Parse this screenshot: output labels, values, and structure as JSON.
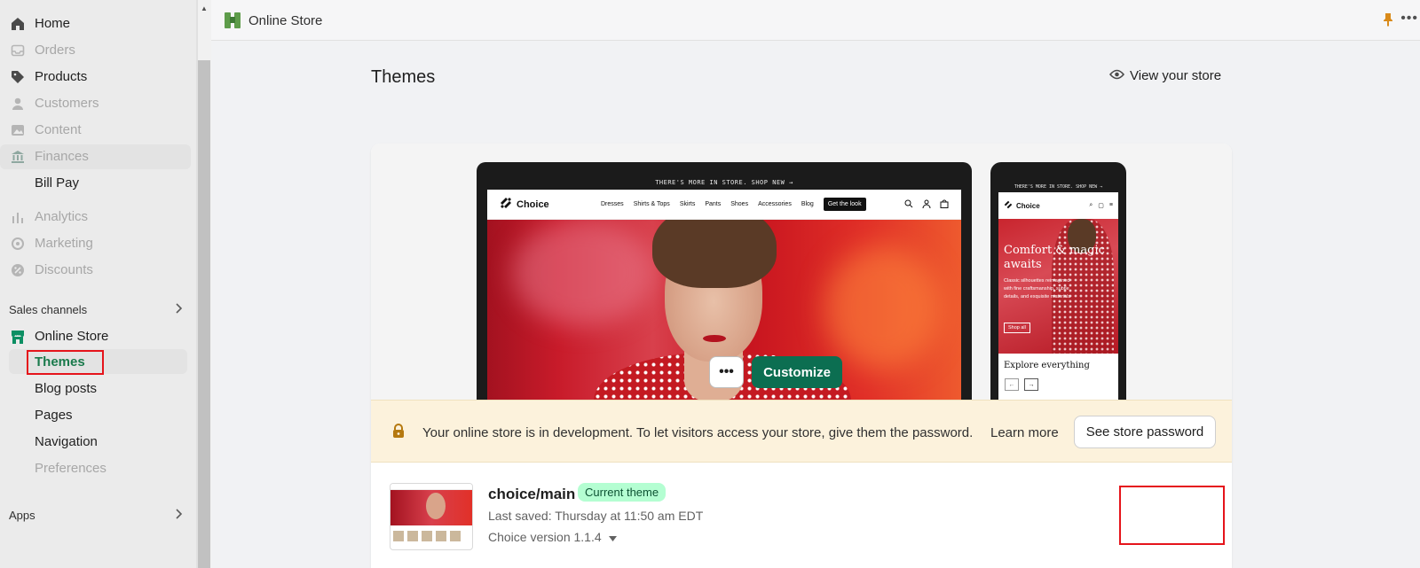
{
  "sidebar": {
    "main_items": [
      {
        "label": "Home",
        "icon": "home-icon"
      },
      {
        "label": "Orders",
        "icon": "inbox-icon"
      },
      {
        "label": "Products",
        "icon": "tag-icon"
      },
      {
        "label": "Customers",
        "icon": "person-icon"
      },
      {
        "label": "Content",
        "icon": "image-icon"
      },
      {
        "label": "Finances",
        "icon": "bank-icon"
      },
      {
        "label": "Bill Pay"
      },
      {
        "label": "Analytics",
        "icon": "bar-chart-icon"
      },
      {
        "label": "Marketing",
        "icon": "target-icon"
      },
      {
        "label": "Discounts",
        "icon": "discount-icon"
      }
    ],
    "sales_channels_label": "Sales channels",
    "online_store": {
      "label": "Online Store",
      "icon": "store-icon"
    },
    "sub_items": [
      {
        "label": "Themes"
      },
      {
        "label": "Blog posts"
      },
      {
        "label": "Pages"
      },
      {
        "label": "Navigation"
      },
      {
        "label": "Preferences"
      }
    ],
    "apps_label": "Apps"
  },
  "topbar": {
    "title": "Online Store",
    "more_label": "•••"
  },
  "page": {
    "title": "Themes",
    "view_store_label": "View your store"
  },
  "preview": {
    "laptop": {
      "announcement": "THERE'S MORE IN STORE. SHOP NEW →",
      "brand": "Choice",
      "links": [
        "Dresses",
        "Shirts & Tops",
        "Skirts",
        "Pants",
        "Shoes",
        "Accessories",
        "Blog"
      ],
      "cta": "Get the look"
    },
    "phone": {
      "announcement": "THERE'S MORE IN STORE. SHOP NEW →",
      "brand": "Choice",
      "hero_title": "Comfort & magic awaits",
      "hero_text": "Classic silhouettes reimagined with fine craftsmanship, subtle details, and exquisite materials",
      "hero_button": "Shop all",
      "explore": "Explore everything",
      "arrow_prev": "←",
      "arrow_next": "→"
    }
  },
  "banner": {
    "message": "Your online store is in development. To let visitors access your store, give them the password.",
    "learn_more": "Learn more",
    "password_button": "See store password"
  },
  "theme": {
    "name": "choice/main",
    "badge": "Current theme",
    "saved": "Last saved: Thursday at 11:50 am EDT",
    "version": "Choice version 1.1.4",
    "more_button": "•••",
    "customize_button": "Customize"
  },
  "colors": {
    "accent_green": "#0c6e51",
    "badge_green": "#b4fed2",
    "banner_bg": "#fcf2dc",
    "highlight_red": "#e5141b"
  }
}
